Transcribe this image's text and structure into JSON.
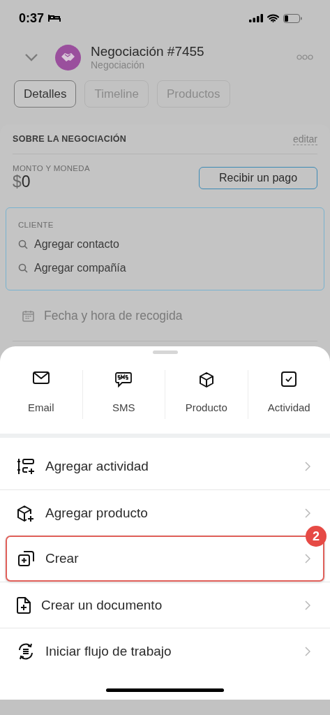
{
  "status_bar": {
    "time": "0:37"
  },
  "header": {
    "title": "Negociación #7455",
    "subtitle": "Negociación"
  },
  "tabs": [
    {
      "label": "Detalles",
      "selected": true
    },
    {
      "label": "Timeline",
      "selected": false
    },
    {
      "label": "Productos",
      "selected": false
    }
  ],
  "card": {
    "title": "SOBRE LA NEGOCIACIÓN",
    "edit_link": "editar",
    "amount_label": "MONTO Y MONEDA",
    "currency": "$",
    "amount": "0",
    "pay_button": "Recibir un pago",
    "client": {
      "label": "CLIENTE",
      "items": [
        "Agregar contacto",
        "Agregar compañía"
      ]
    },
    "date_field": {
      "placeholder": "Fecha y hora de recogida"
    }
  },
  "quick_actions": [
    {
      "label": "Email"
    },
    {
      "label": "SMS"
    },
    {
      "label": "Producto"
    },
    {
      "label": "Actividad"
    }
  ],
  "menu_items": [
    {
      "label": "Agregar actividad",
      "highlighted": false
    },
    {
      "label": "Agregar producto",
      "highlighted": false
    },
    {
      "label": "Crear",
      "highlighted": true,
      "badge": "2"
    },
    {
      "label": "Crear un documento",
      "highlighted": false
    },
    {
      "label": "Iniciar flujo de trabajo",
      "highlighted": false
    }
  ]
}
